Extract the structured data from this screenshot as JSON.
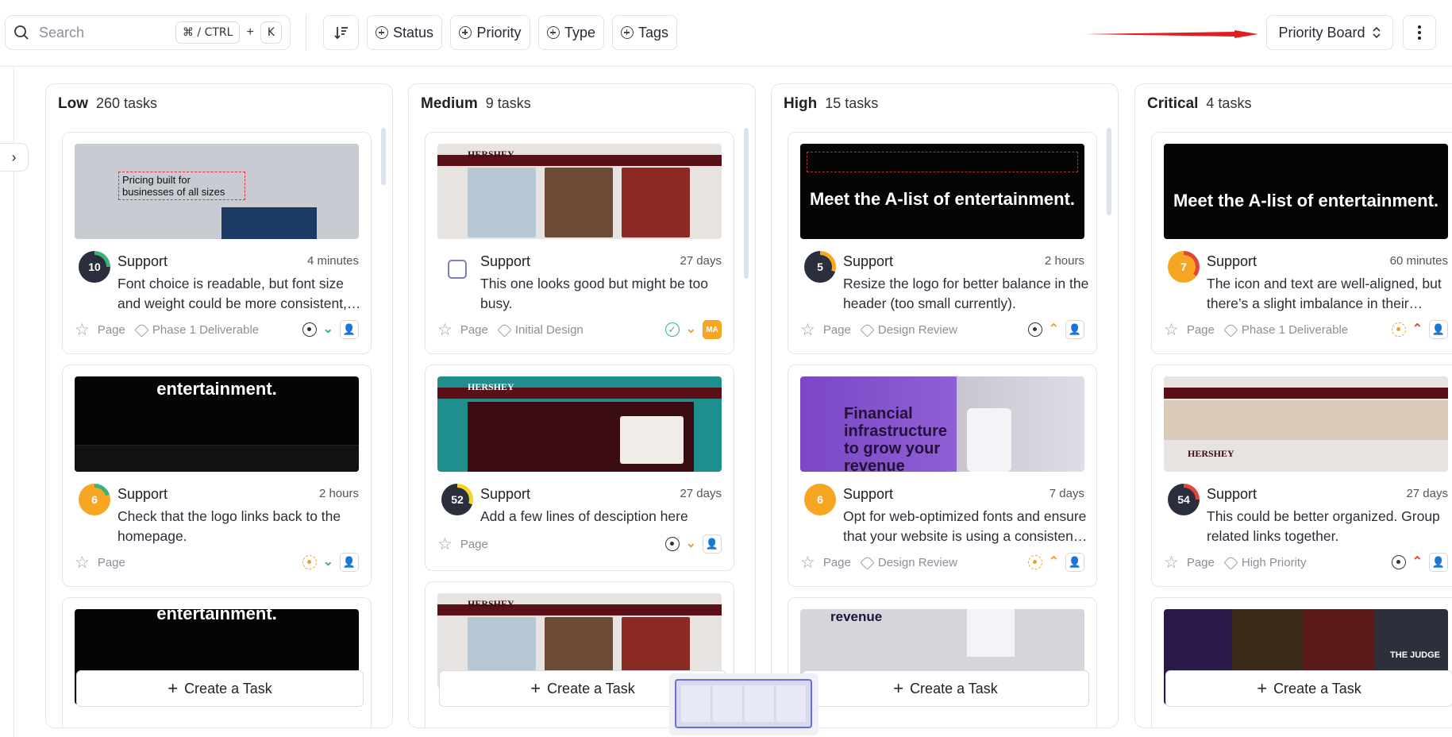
{
  "search": {
    "placeholder": "Search",
    "shortcut_mod": "⌘ / CTRL",
    "shortcut_plus": "+",
    "shortcut_key": "K"
  },
  "filters": {
    "status": "Status",
    "priority": "Priority",
    "type": "Type",
    "tags": "Tags"
  },
  "view_selector": {
    "label": "Priority Board"
  },
  "colors": {
    "accent": "#6b6fd6",
    "arrow": "#e11d1d",
    "avatar_dark": "#2b2f3d",
    "avatar_orange": "#f6a623",
    "status_orange": "#f0a030",
    "priority_green": "#3ab27a",
    "priority_red": "#e0473a"
  },
  "columns": [
    {
      "title": "Low",
      "count": "260 tasks",
      "create_label": "Create a Task",
      "cards": [
        {
          "avatar": "10",
          "category": "Support",
          "time": "4 minutes",
          "desc": "Font choice is readable, but font size and weight could be more consistent, especially in the product descriptions.",
          "page": "Page",
          "tag": "Phase 1 Deliverable",
          "thumb_text": "Pricing built for businesses of all sizes"
        },
        {
          "avatar": "6",
          "category": "Support",
          "time": "2 hours",
          "desc": "Check that the logo links back to the homepage.",
          "page": "Page",
          "tag": "",
          "thumb_text": "entertainment."
        },
        {
          "thumb_text": "entertainment."
        }
      ]
    },
    {
      "title": "Medium",
      "count": "9 tasks",
      "create_label": "Create a Task",
      "cards": [
        {
          "avatar": "",
          "category": "Support",
          "time": "27 days",
          "desc": "This one looks good but might be too busy.",
          "page": "Page",
          "tag": "Initial Design",
          "assignee": "MA",
          "thumb_text": "HERSHEY"
        },
        {
          "avatar": "52",
          "category": "Support",
          "time": "27 days",
          "desc": "Add a few lines of desciption here",
          "page": "Page",
          "tag": "",
          "thumb_text": "HERSHEY"
        },
        {
          "thumb_text": "HERSHEY"
        }
      ]
    },
    {
      "title": "High",
      "count": "15 tasks",
      "create_label": "Create a Task",
      "cards": [
        {
          "avatar": "5",
          "category": "Support",
          "time": "2 hours",
          "desc": "Resize the logo for better balance in the header (too small currently).",
          "page": "Page",
          "tag": "Design Review",
          "thumb_text": "Meet the A-list of entertainment."
        },
        {
          "avatar": "6",
          "category": "Support",
          "time": "7 days",
          "desc": "Opt for web-optimized fonts and ensure that your website is using a consistent set.",
          "page": "Page",
          "tag": "Design Review",
          "thumb_text": "Financial infrastructure to grow your revenue"
        },
        {
          "thumb_text": "revenue"
        }
      ]
    },
    {
      "title": "Critical",
      "count": "4 tasks",
      "create_label": "Create a Task",
      "cards": [
        {
          "avatar": "7",
          "category": "Support",
          "time": "60 minutes",
          "desc": "The icon and text are well-aligned, but there’s a slight imbalance in their spacing.",
          "page": "Page",
          "tag": "Phase 1 Deliverable",
          "thumb_text": "Meet the A-list of entertainment."
        },
        {
          "avatar": "54",
          "category": "Support",
          "time": "27 days",
          "desc": "This could be better organized. Group related links together.",
          "page": "Page",
          "tag": "High Priority",
          "thumb_text": "HERSHEY"
        },
        {
          "thumb_text": "THE JUDGE"
        }
      ]
    }
  ]
}
